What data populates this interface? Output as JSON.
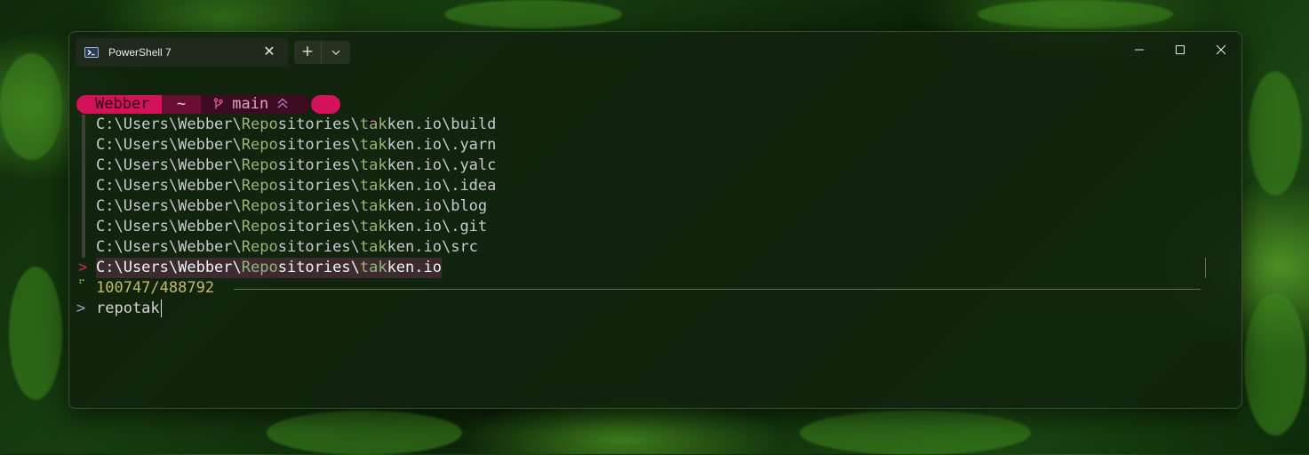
{
  "window": {
    "tab_title": "PowerShell 7",
    "tab_icon": "powershell-icon",
    "new_tab_symbol": "+",
    "close_symbol": "✕"
  },
  "prompt": {
    "user": "Webber",
    "path": "~",
    "branch": "main",
    "colors": {
      "user_bg": "#d3125a",
      "path_bg": "#6a0d34",
      "git_bg": "#3d0b22"
    }
  },
  "results": [
    {
      "pre": "C:\\Users\\Webber\\",
      "m1": "Repo",
      "mid": "sitories\\",
      "m2": "tak",
      "post": "ken.io\\build"
    },
    {
      "pre": "C:\\Users\\Webber\\",
      "m1": "Repo",
      "mid": "sitories\\",
      "m2": "tak",
      "post": "ken.io\\.yarn"
    },
    {
      "pre": "C:\\Users\\Webber\\",
      "m1": "Repo",
      "mid": "sitories\\",
      "m2": "tak",
      "post": "ken.io\\.yalc"
    },
    {
      "pre": "C:\\Users\\Webber\\",
      "m1": "Repo",
      "mid": "sitories\\",
      "m2": "tak",
      "post": "ken.io\\.idea"
    },
    {
      "pre": "C:\\Users\\Webber\\",
      "m1": "Repo",
      "mid": "sitories\\",
      "m2": "tak",
      "post": "ken.io\\blog"
    },
    {
      "pre": "C:\\Users\\Webber\\",
      "m1": "Repo",
      "mid": "sitories\\",
      "m2": "tak",
      "post": "ken.io\\.git"
    },
    {
      "pre": "C:\\Users\\Webber\\",
      "m1": "Repo",
      "mid": "sitories\\",
      "m2": "tak",
      "post": "ken.io\\src"
    }
  ],
  "selected": {
    "marker": ">",
    "pre": "C:\\Users\\Webber\\",
    "m1": "Repo",
    "mid": "sitories\\",
    "m2": "tak",
    "post": "ken.io"
  },
  "count": "100747/488792",
  "query": {
    "prompt": ">",
    "text": "repotak"
  }
}
